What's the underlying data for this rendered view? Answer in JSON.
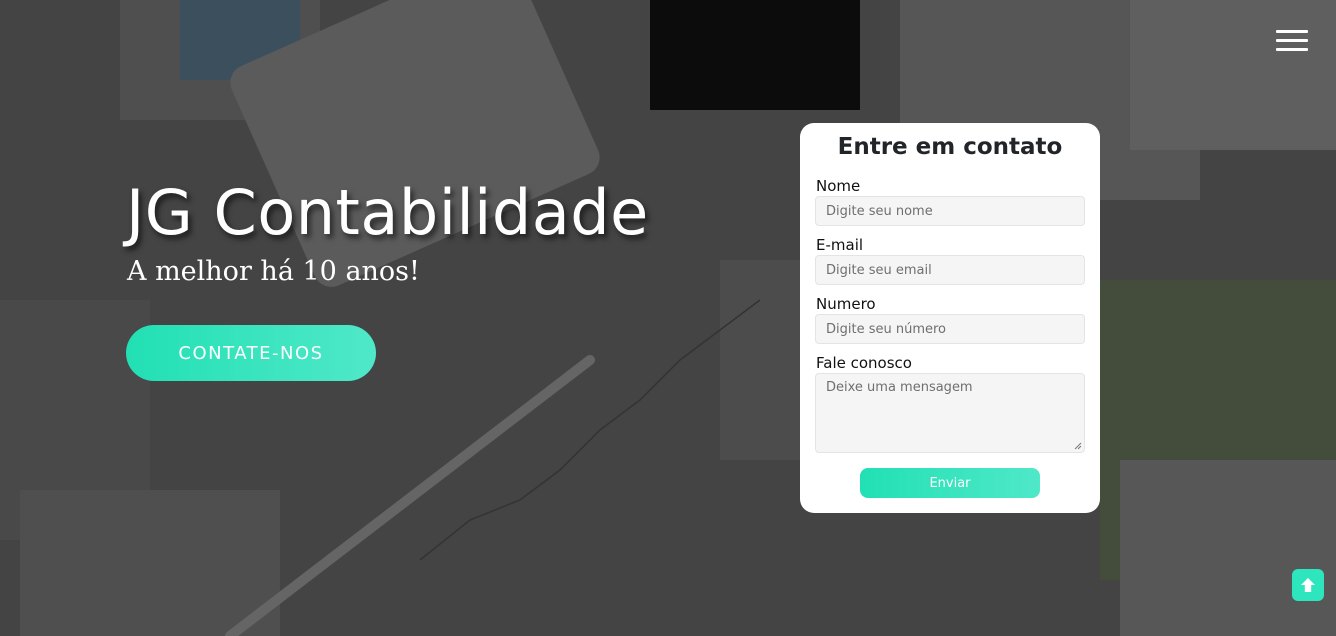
{
  "hero": {
    "title": "JG Contabilidade",
    "subtitle": "A melhor há 10 anos!",
    "cta_label": "CONTATE-NOS",
    "background_icon": "accounting-desk-photo"
  },
  "nav": {
    "menu_icon": "hamburger-menu-icon"
  },
  "contact_form": {
    "title": "Entre em contato",
    "fields": {
      "name": {
        "label": "Nome",
        "placeholder": "Digite seu nome",
        "value": ""
      },
      "email": {
        "label": "E-mail",
        "placeholder": "Digite seu email",
        "value": ""
      },
      "number": {
        "label": "Numero",
        "placeholder": "Digite seu número",
        "value": ""
      },
      "message": {
        "label": "Fale conosco",
        "placeholder": "Deixe uma mensagem",
        "value": ""
      }
    },
    "submit_label": "Enviar"
  },
  "scroll_top": {
    "icon": "arrow-up-icon"
  },
  "colors": {
    "accent": "#2ee6bd",
    "accent_gradient_start": "#22e0b4",
    "accent_gradient_end": "#4fe8c8",
    "card_background": "#ffffff",
    "overlay": "#000000"
  }
}
